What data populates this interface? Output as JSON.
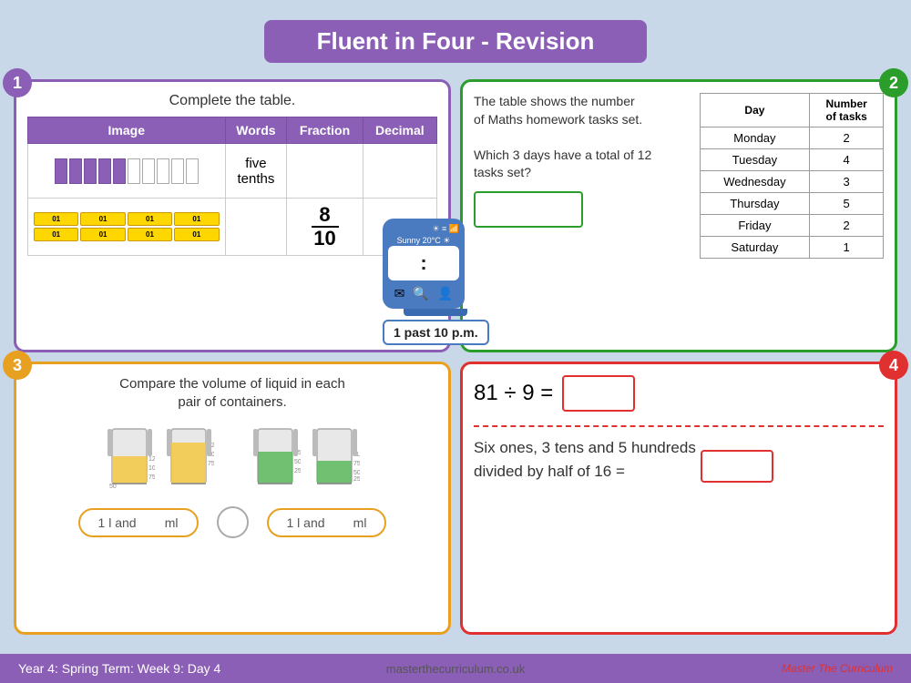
{
  "header": {
    "title": "Fluent in Four - Revision"
  },
  "q1": {
    "badge": "1",
    "title": "Complete the table.",
    "table_headers": [
      "Image",
      "Words",
      "Fraction",
      "Decimal"
    ],
    "row1_words": "five\ntenths",
    "row2_fraction_num": "8",
    "row2_fraction_den": "10"
  },
  "q2": {
    "badge": "2",
    "question_line1": "The table shows the number",
    "question_line2": "of Maths homework tasks set.",
    "question_line3": "Which 3 days have a total of 12",
    "question_line4": "tasks set?",
    "table_headers": [
      "Day",
      "Number of tasks"
    ],
    "days": [
      {
        "day": "Monday",
        "tasks": "2"
      },
      {
        "day": "Tuesday",
        "tasks": "4"
      },
      {
        "day": "Wednesday",
        "tasks": "3"
      },
      {
        "day": "Thursday",
        "tasks": "5"
      },
      {
        "day": "Friday",
        "tasks": "2"
      },
      {
        "day": "Saturday",
        "tasks": "1"
      }
    ]
  },
  "q3": {
    "badge": "3",
    "title": "Compare the volume of liquid in each\npair of containers.",
    "answer1_prefix": "1 l and",
    "answer1_suffix": "ml",
    "answer2_prefix": "1 l and",
    "answer2_suffix": "ml"
  },
  "q4": {
    "badge": "4",
    "equation": "81 ÷ 9 =",
    "question": "Six ones, 3 tens and 5 hundreds\ndivided by half of 16 ="
  },
  "footer": {
    "left": "Year 4: Spring Term: Week 9: Day 4",
    "center": "masterthecurriculum.co.uk",
    "right": "Master The Curriculum"
  },
  "watch": {
    "status": "Sunny 20°C ☀",
    "time": ":",
    "label": "1 past 10 p.m."
  }
}
